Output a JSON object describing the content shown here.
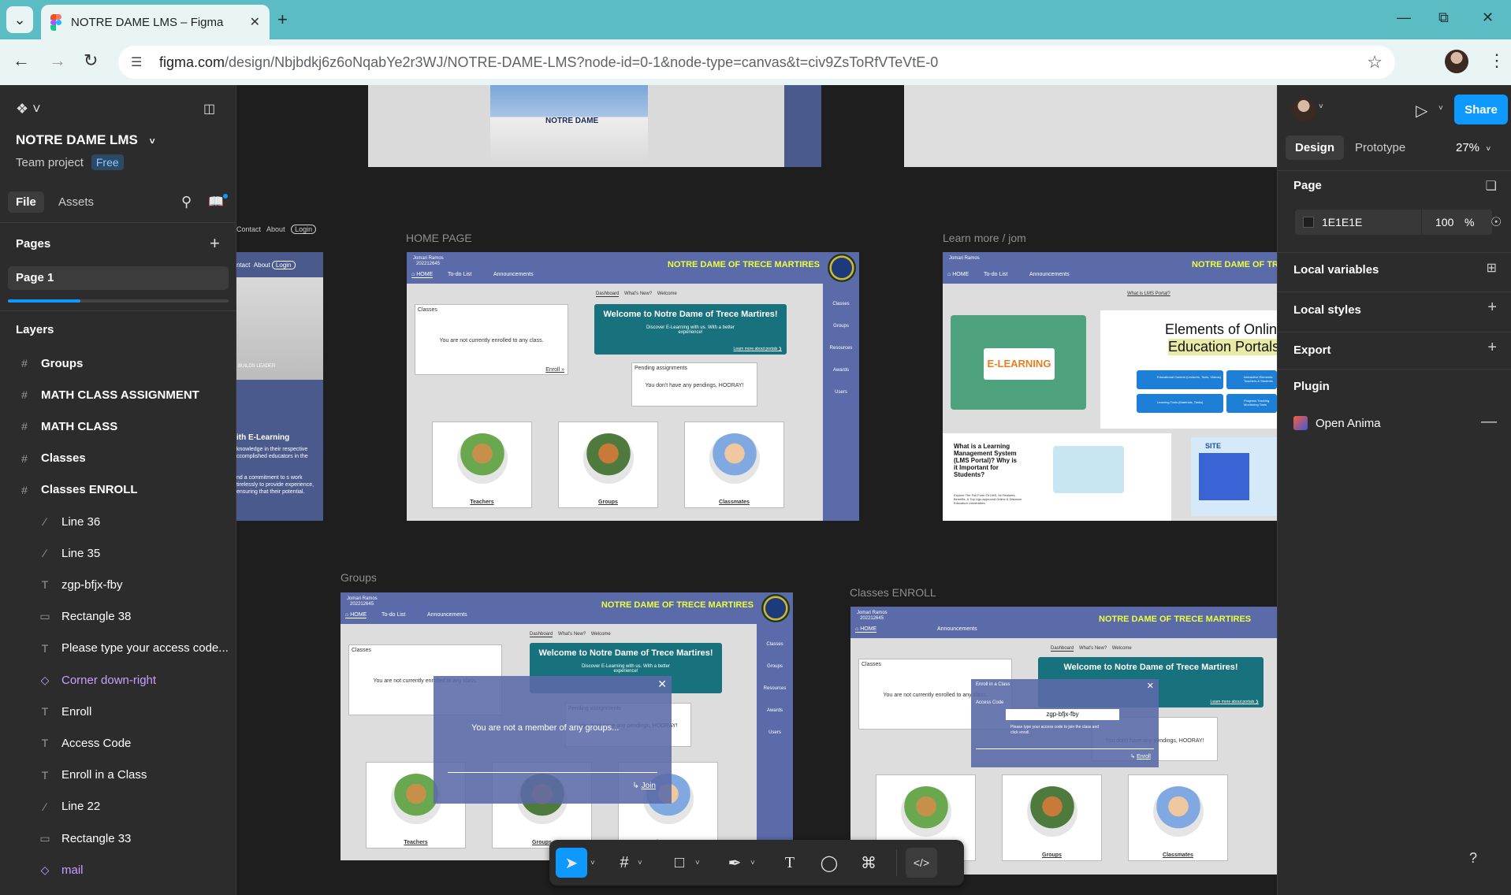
{
  "browser": {
    "tab_title": "NOTRE DAME LMS – Figma",
    "url_host": "figma.com",
    "url_path": "/design/Nbjbdkj6z6oNqabYe2r3WJ/NOTRE-DAME-LMS?node-id=0-1&node-type=canvas&t=civ9ZsToRfVTeVtE-0"
  },
  "left_panel": {
    "project_name": "NOTRE DAME LMS",
    "team": "Team project",
    "plan_badge": "Free",
    "tabs": {
      "file": "File",
      "assets": "Assets"
    },
    "pages_title": "Pages",
    "pages": [
      "Page 1"
    ],
    "layers_title": "Layers",
    "layers": [
      {
        "name": "Groups",
        "icon": "frame-icon",
        "bold": true
      },
      {
        "name": "MATH CLASS ASSIGNMENT",
        "icon": "frame-icon",
        "bold": true
      },
      {
        "name": "MATH CLASS",
        "icon": "frame-icon",
        "bold": true
      },
      {
        "name": "Classes",
        "icon": "frame-icon",
        "bold": true
      },
      {
        "name": "Classes ENROLL",
        "icon": "frame-icon",
        "bold": true
      },
      {
        "name": "Line 36",
        "icon": "line-icon"
      },
      {
        "name": "Line 35",
        "icon": "line-icon"
      },
      {
        "name": "zgp-bfjx-fby",
        "icon": "text-icon"
      },
      {
        "name": "Rectangle 38",
        "icon": "rectangle-icon"
      },
      {
        "name": "Please type your access code...",
        "icon": "text-icon"
      },
      {
        "name": "Corner down-right",
        "icon": "component-icon",
        "component": true
      },
      {
        "name": "Enroll",
        "icon": "text-icon"
      },
      {
        "name": "Access Code",
        "icon": "text-icon"
      },
      {
        "name": "Enroll in a Class",
        "icon": "text-icon"
      },
      {
        "name": "Line 22",
        "icon": "line-icon"
      },
      {
        "name": "Rectangle 33",
        "icon": "rectangle-icon"
      },
      {
        "name": "mail",
        "icon": "component-icon",
        "component": true
      }
    ]
  },
  "right_panel": {
    "share": "Share",
    "tabs": {
      "design": "Design",
      "prototype": "Prototype"
    },
    "zoom": "27%",
    "page_section": "Page",
    "page_color": "1E1E1E",
    "page_opacity": "100",
    "page_opacity_unit": "%",
    "local_variables": "Local variables",
    "local_styles": "Local styles",
    "export": "Export",
    "plugin": "Plugin",
    "plugin_name": "Open Anima"
  },
  "canvas": {
    "frame_labels": {
      "home": "HOME PAGE",
      "learn": "Learn more / jom",
      "groups": "Groups",
      "enroll": "Classes ENROLL"
    },
    "landing_nav": {
      "contact": "Contact",
      "about": "About",
      "login": "Login"
    },
    "landing_text": {
      "heading": "ith E-Learning",
      "body": "knowledge in their respective ccomplished educators in the",
      "body2": "nd a commitment to s work tirelessly to provide experience, ensuring that their potential.",
      "banner": "BUILDS LEADER"
    },
    "lms": {
      "school": "NOTRE DAME OF TRECE MARTIRES",
      "user_name": "Jomari Ramos",
      "user_id": "202212645",
      "nav_home": "HOME",
      "nav_todo": "To-do List",
      "nav_announcements": "Announcements",
      "tabs": [
        "Dashboard",
        "What's New?",
        "Welcome"
      ],
      "classes_title": "Classes",
      "no_class": "You are not currently enrolled to any class.",
      "enroll_link": "Enroll »",
      "welcome_title": "Welcome to Notre Dame of Trece Martires!",
      "welcome_body": "Discover E-Learning with us. With a better experience!",
      "learn_more": "Learn more about portals ❯",
      "pending_title": "Pending assignments",
      "pending_body": "You don't have any pendings, HOORAY!",
      "cards": [
        "Teachers",
        "Groups",
        "Classmates"
      ],
      "side": [
        "Classes",
        "Groups",
        "Resources",
        "Awards",
        "Users"
      ]
    },
    "learn": {
      "heading1": "Elements of Onlin",
      "heading2": "Education Portals",
      "elearning": "E-LEARNING",
      "what_is_portal": "What is LMS Portal?",
      "what_lms": "What is a Learning Management System (LMS Portal)? Why is it Important for Students?",
      "explore": "Explore The Full Form Of LMS, Its Features, Benefits, & Top Ugc-approved Online & Distance Education Universities.",
      "pills": [
        "Educational Content (Lectures, Texts, Videos)",
        "Interactive Elements: Teachers & Students",
        "Learning Tools (Materials, Tasks)",
        "Progress Tracking, Monitoring Tools"
      ],
      "site_word": "SITE"
    },
    "groups_modal": {
      "message": "You are not a member of any groups...",
      "join": "Join"
    },
    "enroll_modal": {
      "title": "Enroll in a Class",
      "access_label": "Access Code",
      "code": "zgp-bfjx-fby",
      "hint": "Please type your access code to join the class and click enroll.",
      "enroll": "Enroll"
    }
  }
}
